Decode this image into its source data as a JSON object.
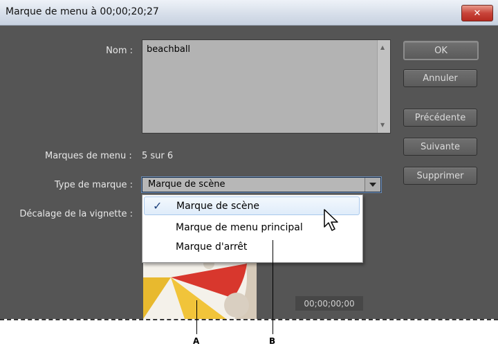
{
  "window": {
    "title": "Marque de menu à 00;00;20;27",
    "close_glyph": "✕"
  },
  "fields": {
    "name_label": "Nom :",
    "name_value": "beachball",
    "menu_markers_label": "Marques de menu :",
    "menu_markers_value": "5 sur 6",
    "marker_type_label": "Type de marque :",
    "marker_type_value": "Marque de scène",
    "thumbnail_offset_label": "Décalage de la vignette :"
  },
  "buttons": {
    "ok": "OK",
    "cancel": "Annuler",
    "previous": "Précédente",
    "next": "Suivante",
    "delete": "Supprimer"
  },
  "dropdown": {
    "options": [
      "Marque de scène",
      "Marque de menu principal",
      "Marque d'arrêt"
    ],
    "selected_index": 0,
    "check_glyph": "✓"
  },
  "thumbnail": {
    "timecode": "00;00;00;00"
  },
  "callouts": {
    "a": "A",
    "b": "B"
  },
  "icons": [
    "close-icon",
    "scroll-up-icon",
    "scroll-down-icon",
    "dropdown-arrow-icon",
    "checkmark-icon",
    "mouse-cursor-icon"
  ]
}
